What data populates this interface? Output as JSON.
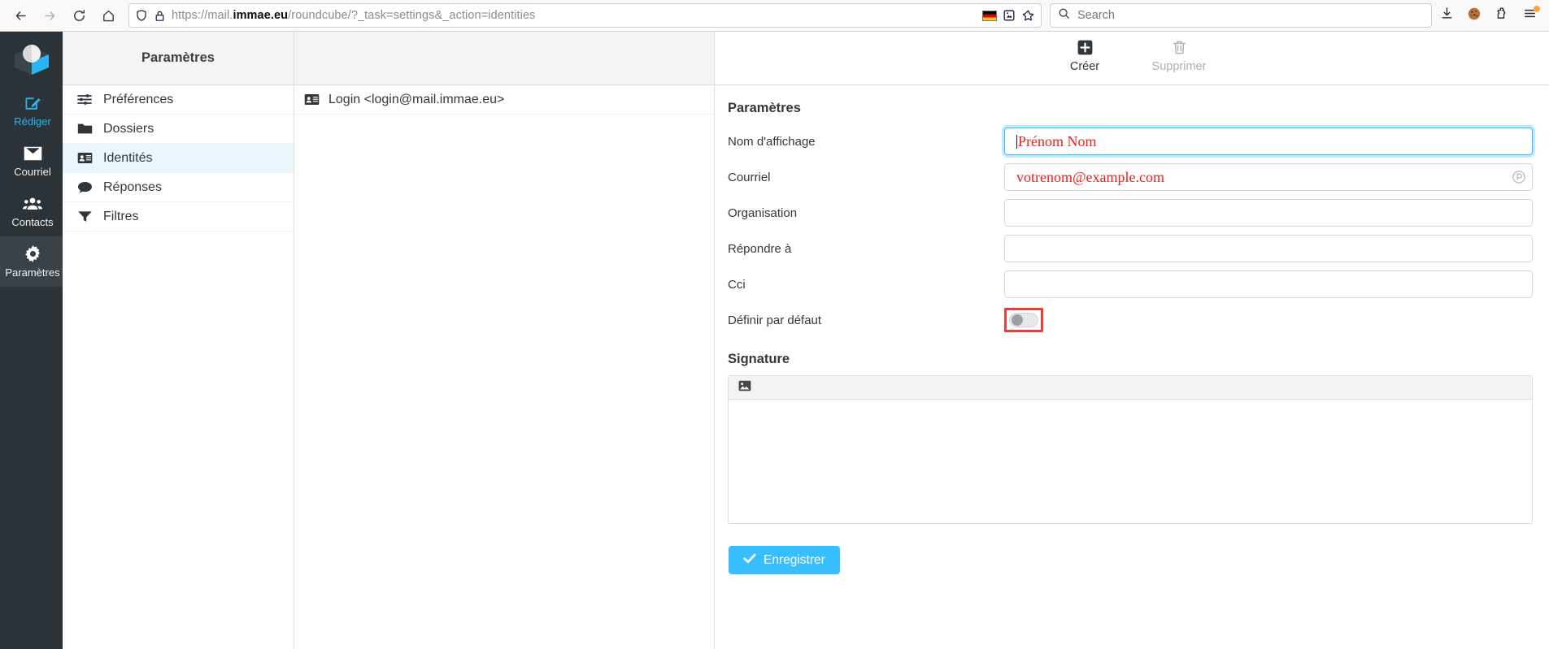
{
  "browser": {
    "back_icon": "back-arrow-icon",
    "forward_icon": "forward-arrow-icon",
    "reload_icon": "reload-icon",
    "home_icon": "home-icon",
    "url_prefix": "https://mail.",
    "url_bold": "immae.eu",
    "url_suffix": "/roundcube/?_task=settings&_action=identities",
    "url_full": "https://mail.immae.eu/roundcube/?_task=settings&_action=identities",
    "shield_icon": "tracking-protection-shield-icon",
    "lock_icon": "padlock-icon",
    "flag_icon": "german-flag-icon",
    "reader_icon": "reader-view-icon",
    "bookmark_icon": "star-bookmark-icon",
    "search_icon": "search-icon",
    "search_placeholder": "Search",
    "downloads_icon": "downloads-arrow-icon",
    "cookies_icon": "cookie-icon",
    "extensions_icon": "extensions-puzzle-icon",
    "menu_icon": "hamburger-menu-icon"
  },
  "taskmenu": {
    "logo": "roundcube-cube-logo",
    "items": [
      {
        "label": "Rédiger",
        "icon": "compose-pencil-icon",
        "name": "compose"
      },
      {
        "label": "Courriel",
        "icon": "envelope-icon",
        "name": "mail"
      },
      {
        "label": "Contacts",
        "icon": "contacts-group-icon",
        "name": "contacts"
      },
      {
        "label": "Paramètres",
        "icon": "gear-icon",
        "name": "settings"
      }
    ]
  },
  "settings_list": {
    "header": "Paramètres",
    "items": [
      {
        "label": "Préférences",
        "icon": "sliders-icon"
      },
      {
        "label": "Dossiers",
        "icon": "folder-icon"
      },
      {
        "label": "Identités",
        "icon": "identity-card-icon"
      },
      {
        "label": "Réponses",
        "icon": "speech-bubble-icon"
      },
      {
        "label": "Filtres",
        "icon": "funnel-filter-icon"
      }
    ]
  },
  "identities_list": {
    "header": "",
    "items": [
      {
        "label": "Login <login@mail.immae.eu>",
        "icon": "identity-card-icon"
      }
    ]
  },
  "content": {
    "toolbar": {
      "create_label": "Créer",
      "create_icon": "plus-square-icon",
      "delete_label": "Supprimer",
      "delete_icon": "trash-icon"
    },
    "settings_section_title": "Paramètres",
    "fields": [
      {
        "label": "Nom d'affichage",
        "value": "Prénom Nom",
        "focused": true,
        "has_caret": true,
        "badge": ""
      },
      {
        "label": "Courriel",
        "value": "votrenom@example.com",
        "focused": false,
        "has_caret": false,
        "badge": "password-manager-icon"
      },
      {
        "label": "Organisation",
        "value": "",
        "focused": false,
        "has_caret": false,
        "badge": ""
      },
      {
        "label": "Répondre à",
        "value": "",
        "focused": false,
        "has_caret": false,
        "badge": ""
      },
      {
        "label": "Cci",
        "value": "",
        "focused": false,
        "has_caret": false,
        "badge": ""
      }
    ],
    "default_toggle": {
      "label": "Définir par défaut",
      "state": "off",
      "annotation_color": "#ec3c38"
    },
    "signature_title": "Signature",
    "signature_toolbar_icon": "insert-image-icon",
    "signature_value": "",
    "save_label": "Enregistrer",
    "save_icon": "check-icon"
  },
  "colors": {
    "accent_blue": "#37beff",
    "taskmenu_bg": "#2c3338",
    "selected_row": "#eaf6fd",
    "value_red": "#e8231f",
    "annotation_red": "#ec3c38"
  }
}
